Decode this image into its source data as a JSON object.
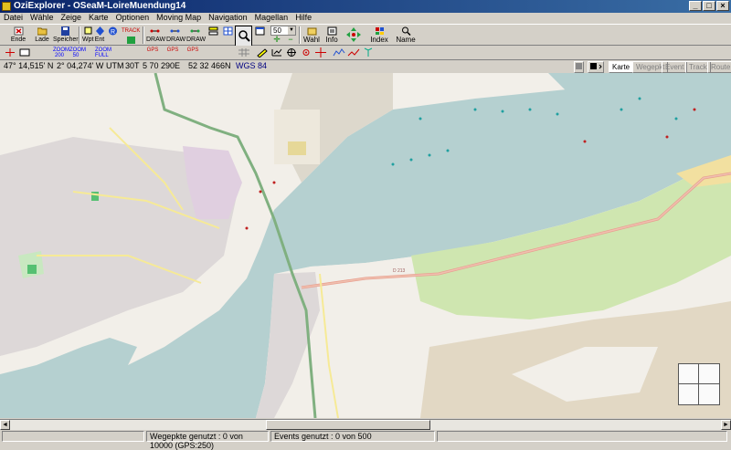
{
  "window": {
    "title": "OziExplorer - OSeaM-LoireMuendung14",
    "controls": [
      "_",
      "□",
      "×"
    ]
  },
  "menu": [
    "Datei",
    "Wähle",
    "Zeige",
    "Karte",
    "Optionen",
    "Moving Map",
    "Navigation",
    "Magellan",
    "Hilfe"
  ],
  "toolbar": {
    "end": "Ende",
    "load": "Lade",
    "save": "Speicher",
    "wpt": "Wpt",
    "ent": "Ent",
    "trk": "TRACK",
    "zoom_200": "ZOOM\n200",
    "zoom_50": "ZOOM\n50",
    "zoom_full": "ZOOM\nFULL",
    "zoom_value": "50",
    "wahl": "Wahl",
    "info": "Info",
    "index": "Index",
    "name": "Name",
    "draw1": "DRAW",
    "draw2": "DRAW",
    "draw3": "DRAW",
    "gps1": "GPS",
    "gps2": "GPS",
    "gps3": "GPS"
  },
  "coords": {
    "lat": "47° 14,515' N",
    "lon": "2° 04,274' W",
    "utm_label": "UTM",
    "utm_zone": "30T",
    "easting": "5 70 290E",
    "northing": "52 32 466N",
    "datum": "WGS 84"
  },
  "tabs": [
    "Karte",
    "Wegepkt",
    "Event",
    "Track",
    "Route"
  ],
  "status": {
    "waypoints": "Wegepkte genutzt : 0 von 10000  (GPS:250)",
    "events": "Events genutzt : 0 von 500"
  },
  "map_labels": {
    "road_d": "D 213"
  }
}
